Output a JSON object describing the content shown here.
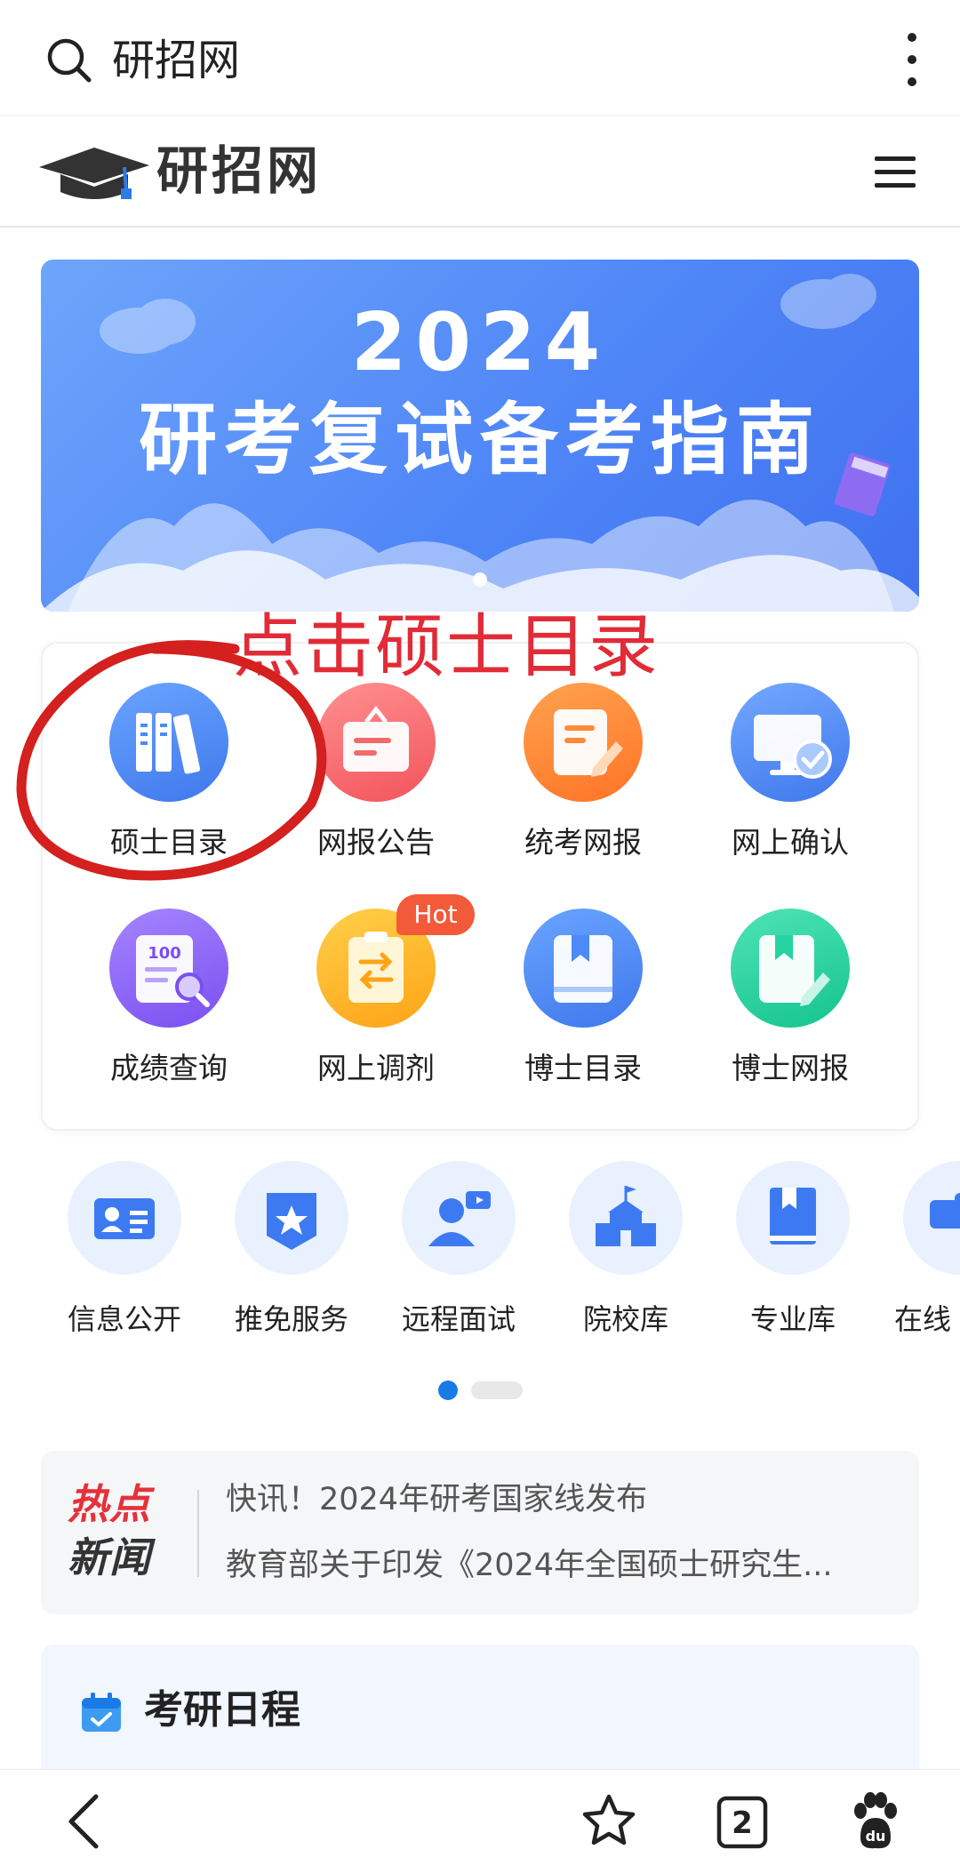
{
  "search_bar": {
    "query": "研招网"
  },
  "site": {
    "logo_text": "研招网"
  },
  "banner": {
    "year": "2024",
    "title": "研考复试备考指南"
  },
  "annotation": {
    "text": "点击硕士目录"
  },
  "quick_grid": {
    "items": [
      {
        "label": "硕士目录",
        "icon": "bookshelf-icon",
        "color": "#4c8af5"
      },
      {
        "label": "网报公告",
        "icon": "notice-board-icon",
        "color": "#fa6a6a"
      },
      {
        "label": "统考网报",
        "icon": "edit-document-icon",
        "color": "#ff8a38"
      },
      {
        "label": "网上确认",
        "icon": "computer-check-icon",
        "color": "#4d8cf6"
      },
      {
        "label": "成绩查询",
        "icon": "score-search-icon",
        "color": "#8a62f3"
      },
      {
        "label": "网上调剂",
        "icon": "transfer-icon",
        "color": "#ffb11f"
      },
      {
        "label": "博士目录",
        "icon": "book-icon",
        "color": "#4c8af5"
      },
      {
        "label": "博士网报",
        "icon": "book-edit-icon",
        "color": "#24d3a1"
      }
    ],
    "hot_badge": "Hot"
  },
  "services": {
    "items": [
      {
        "label": "信息公开",
        "icon": "id-card-icon"
      },
      {
        "label": "推免服务",
        "icon": "star-badge-icon"
      },
      {
        "label": "远程面试",
        "icon": "video-interview-icon"
      },
      {
        "label": "院校库",
        "icon": "school-icon"
      },
      {
        "label": "专业库",
        "icon": "major-book-icon"
      },
      {
        "label": "在线",
        "icon": "chat-icon"
      }
    ],
    "page": 1,
    "pages": 2
  },
  "hot_news": {
    "badge_line1": "热点",
    "badge_line2": "新闻",
    "items": [
      "快讯！2024年研考国家线发布",
      "教育部关于印发《2024年全国硕士研究生..."
    ]
  },
  "schedule": {
    "title": "考研日程"
  },
  "bottom_nav": {
    "tab_count": "2"
  },
  "colors": {
    "accent": "#4c8af5",
    "annotation": "#e12b37",
    "hot": "#f25a3a"
  }
}
